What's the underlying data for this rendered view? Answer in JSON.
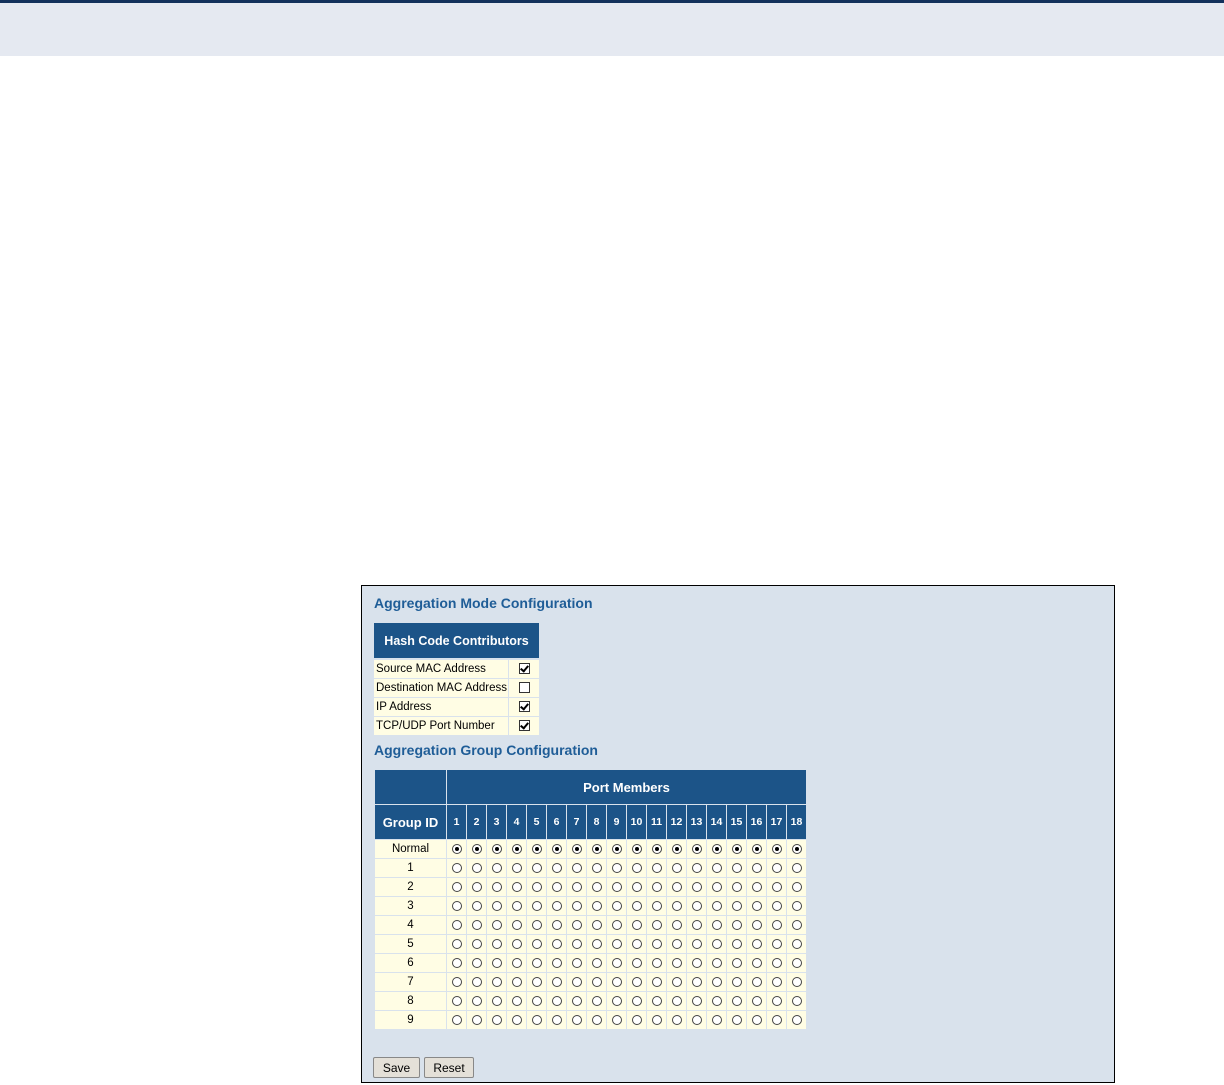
{
  "mode_config": {
    "title": "Aggregation Mode Configuration",
    "hash_header": "Hash Code Contributors",
    "contributors": [
      {
        "label": "Source MAC Address",
        "checked": true
      },
      {
        "label": "Destination MAC Address",
        "checked": false
      },
      {
        "label": "IP Address",
        "checked": true
      },
      {
        "label": "TCP/UDP Port Number",
        "checked": true
      }
    ]
  },
  "group_config": {
    "title": "Aggregation Group Configuration",
    "group_id_header": "Group ID",
    "port_members_header": "Port Members",
    "ports": [
      "1",
      "2",
      "3",
      "4",
      "5",
      "6",
      "7",
      "8",
      "9",
      "10",
      "11",
      "12",
      "13",
      "14",
      "15",
      "16",
      "17",
      "18"
    ],
    "groups": [
      "Normal",
      "1",
      "2",
      "3",
      "4",
      "5",
      "6",
      "7",
      "8",
      "9"
    ],
    "selected_group_per_port": [
      "Normal",
      "Normal",
      "Normal",
      "Normal",
      "Normal",
      "Normal",
      "Normal",
      "Normal",
      "Normal",
      "Normal",
      "Normal",
      "Normal",
      "Normal",
      "Normal",
      "Normal",
      "Normal",
      "Normal",
      "Normal"
    ]
  },
  "buttons": {
    "save_label": "Save",
    "reset_label": "Reset"
  },
  "colors": {
    "header_bg": "#1c5488",
    "title_text": "#1f5d97",
    "cell_bg": "#fffde4",
    "panel_bg": "#d9e2ec"
  }
}
